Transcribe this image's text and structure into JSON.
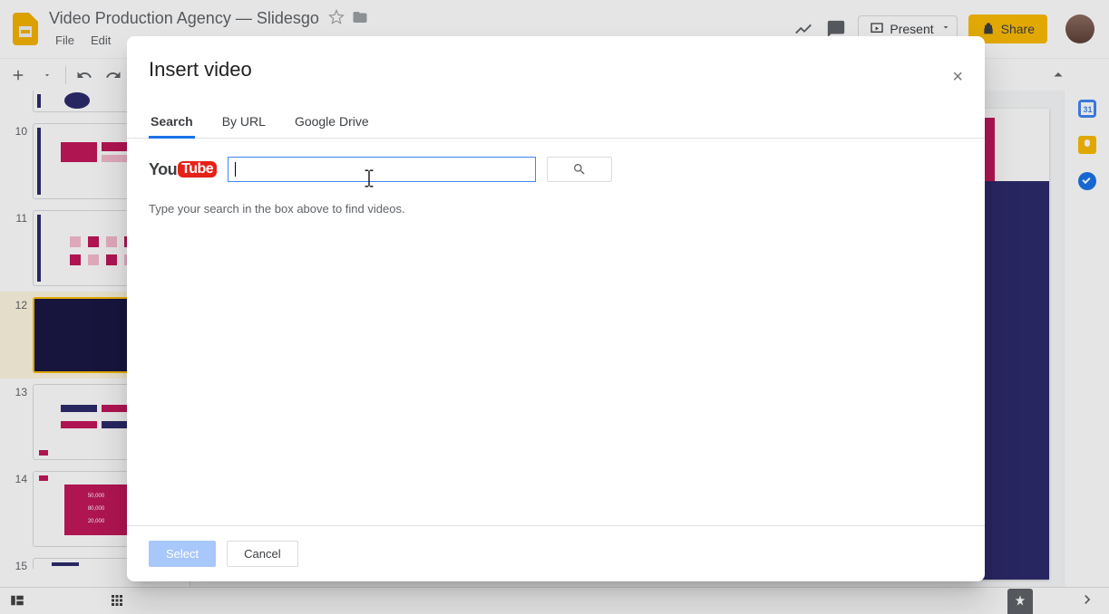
{
  "header": {
    "doc_title": "Video Production Agency — Slidesgo",
    "menu": {
      "file": "File",
      "edit": "Edit"
    },
    "present": "Present",
    "share": "Share"
  },
  "thumbnails": {
    "visible_start": 9,
    "items": [
      {
        "num": ""
      },
      {
        "num": "10"
      },
      {
        "num": "11"
      },
      {
        "num": "12",
        "active": true
      },
      {
        "num": "13"
      },
      {
        "num": "14"
      },
      {
        "num": "15"
      }
    ]
  },
  "thumb14_values": {
    "a": "50,000",
    "b": "80,000",
    "c": "20,000"
  },
  "modal": {
    "title": "Insert video",
    "tabs": {
      "search": "Search",
      "by_url": "By URL",
      "drive": "Google Drive"
    },
    "youtube": {
      "you": "You",
      "tube": "Tube"
    },
    "search_value": "",
    "hint": "Type your search in the box above to find videos.",
    "select": "Select",
    "cancel": "Cancel"
  }
}
